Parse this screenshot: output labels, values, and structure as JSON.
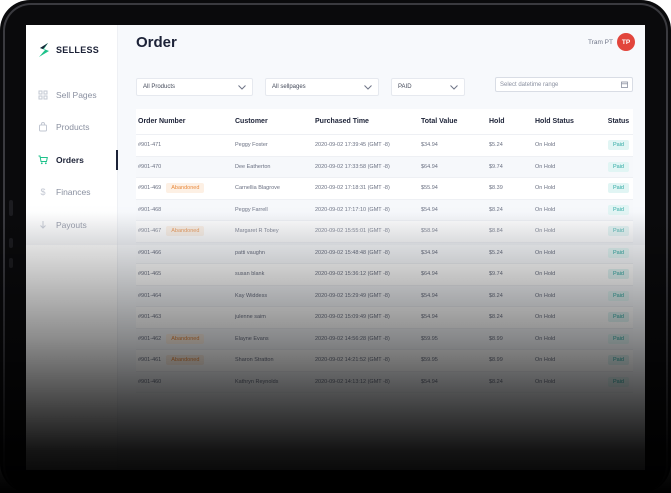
{
  "app": {
    "logo_text": "SELLESS",
    "brand_color": "#1ec28b"
  },
  "sidebar": {
    "items": [
      {
        "label": "Sell Pages",
        "icon": "grid-icon"
      },
      {
        "label": "Products",
        "icon": "bag-icon"
      },
      {
        "label": "Orders",
        "icon": "cart-icon",
        "active": true
      },
      {
        "label": "Finances",
        "icon": "dollar-icon"
      },
      {
        "label": "Payouts",
        "icon": "arrow-down-icon"
      }
    ]
  },
  "header": {
    "title": "Order",
    "user_name": "Tram PT",
    "avatar_initials": "TP",
    "avatar_color": "#e2453c"
  },
  "filters": {
    "products": "All Products",
    "sellpages": "All sellpages",
    "status": "PAID",
    "date_placeholder": "Select datetime range"
  },
  "table": {
    "columns": [
      "Order Number",
      "Customer",
      "Purchased Time",
      "Total Value",
      "Hold",
      "Hold Status",
      "Status"
    ],
    "rows": [
      {
        "order": "#901-471",
        "abandoned": "",
        "customer": "Peggy Foster",
        "time": "2020-09-02 17:39:45 (GMT -8)",
        "total": "$34.94",
        "hold": "$5.24",
        "hold_status": "On Hold",
        "status": "Paid"
      },
      {
        "order": "#901-470",
        "abandoned": "",
        "customer": "Dee Eatherton",
        "time": "2020-09-02 17:33:58 (GMT -8)",
        "total": "$64.94",
        "hold": "$9.74",
        "hold_status": "On Hold",
        "status": "Paid"
      },
      {
        "order": "#901-469",
        "abandoned": "Abandoned",
        "customer": "Carnellia Blagrove",
        "time": "2020-09-02 17:18:31 (GMT -8)",
        "total": "$55.94",
        "hold": "$8.39",
        "hold_status": "On Hold",
        "status": "Paid"
      },
      {
        "order": "#901-468",
        "abandoned": "",
        "customer": "Peggy Farrell",
        "time": "2020-09-02 17:17:10 (GMT -8)",
        "total": "$54.94",
        "hold": "$8.24",
        "hold_status": "On Hold",
        "status": "Paid"
      },
      {
        "order": "#901-467",
        "abandoned": "Abandoned",
        "customer": "Margaret R Tobey",
        "time": "2020-09-02 15:55:01 (GMT -8)",
        "total": "$58.94",
        "hold": "$8.84",
        "hold_status": "On Hold",
        "status": "Paid"
      },
      {
        "order": "#901-466",
        "abandoned": "",
        "customer": "patti vaughn",
        "time": "2020-09-02 15:48:48 (GMT -8)",
        "total": "$34.94",
        "hold": "$5.24",
        "hold_status": "On Hold",
        "status": "Paid"
      },
      {
        "order": "#901-465",
        "abandoned": "",
        "customer": "susan blank",
        "time": "2020-09-02 15:36:12 (GMT -8)",
        "total": "$64.94",
        "hold": "$9.74",
        "hold_status": "On Hold",
        "status": "Paid"
      },
      {
        "order": "#901-464",
        "abandoned": "",
        "customer": "Kay Widdess",
        "time": "2020-09-02 15:29:49 (GMT -8)",
        "total": "$54.94",
        "hold": "$8.24",
        "hold_status": "On Hold",
        "status": "Paid"
      },
      {
        "order": "#901-463",
        "abandoned": "",
        "customer": "julenne saim",
        "time": "2020-09-02 15:09:49 (GMT -8)",
        "total": "$54.94",
        "hold": "$8.24",
        "hold_status": "On Hold",
        "status": "Paid"
      },
      {
        "order": "#901-462",
        "abandoned": "Abandoned",
        "customer": "Elayne Evans",
        "time": "2020-09-02 14:56:28 (GMT -8)",
        "total": "$59.95",
        "hold": "$8.99",
        "hold_status": "On Hold",
        "status": "Paid"
      },
      {
        "order": "#901-461",
        "abandoned": "Abandoned",
        "customer": "Sharon Stratton",
        "time": "2020-09-02 14:21:52 (GMT -8)",
        "total": "$59.95",
        "hold": "$8.99",
        "hold_status": "On Hold",
        "status": "Paid"
      },
      {
        "order": "#901-460",
        "abandoned": "",
        "customer": "Kathryn Reynolds",
        "time": "2020-09-02 14:13:12 (GMT -8)",
        "total": "$54.94",
        "hold": "$8.24",
        "hold_status": "On Hold",
        "status": "Paid"
      }
    ]
  }
}
